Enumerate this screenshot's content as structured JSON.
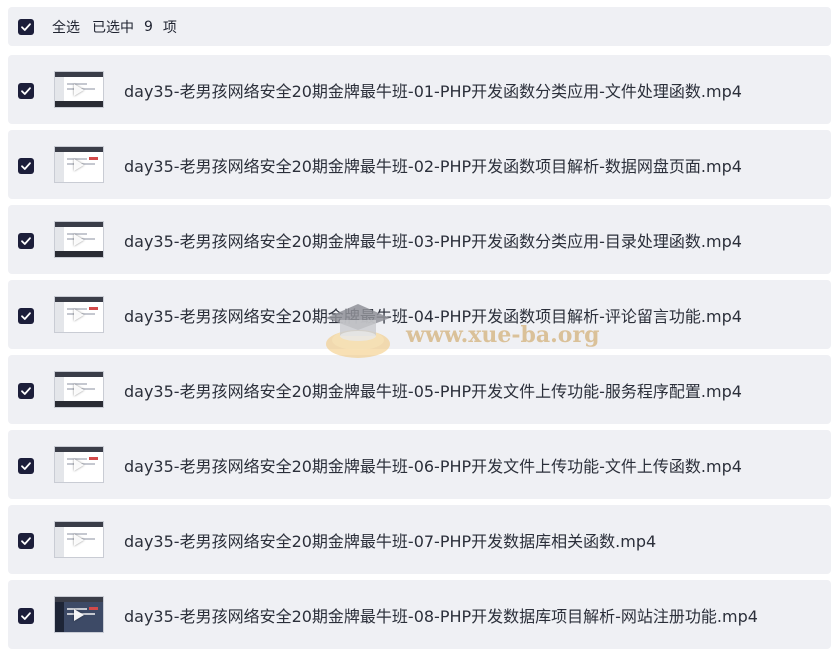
{
  "header": {
    "select_all_label": "全选",
    "selected_prefix": "已选中",
    "selected_count": "9",
    "selected_unit": "项"
  },
  "files": [
    {
      "name": "day35-老男孩网络安全20期金牌最牛班-01-PHP开发函数分类应用-文件处理函数.mp4",
      "checked": true
    },
    {
      "name": "day35-老男孩网络安全20期金牌最牛班-02-PHP开发函数项目解析-数据网盘页面.mp4",
      "checked": true
    },
    {
      "name": "day35-老男孩网络安全20期金牌最牛班-03-PHP开发函数分类应用-目录处理函数.mp4",
      "checked": true
    },
    {
      "name": "day35-老男孩网络安全20期金牌最牛班-04-PHP开发函数项目解析-评论留言功能.mp4",
      "checked": true
    },
    {
      "name": "day35-老男孩网络安全20期金牌最牛班-05-PHP开发文件上传功能-服务程序配置.mp4",
      "checked": true
    },
    {
      "name": "day35-老男孩网络安全20期金牌最牛班-06-PHP开发文件上传功能-文件上传函数.mp4",
      "checked": true
    },
    {
      "name": "day35-老男孩网络安全20期金牌最牛班-07-PHP开发数据库相关函数.mp4",
      "checked": true
    },
    {
      "name": "day35-老男孩网络安全20期金牌最牛班-08-PHP开发数据库项目解析-网站注册功能.mp4",
      "checked": true
    }
  ],
  "watermark": {
    "text": "www.xue-ba.org"
  },
  "colors": {
    "checkbox": "#1c1e3a",
    "row_bg": "#eff0f4",
    "watermark": "#d7b98a"
  },
  "icons": {
    "checkbox": "checkmark-icon",
    "thumbnail": "video-thumbnail",
    "play": "play-icon"
  }
}
